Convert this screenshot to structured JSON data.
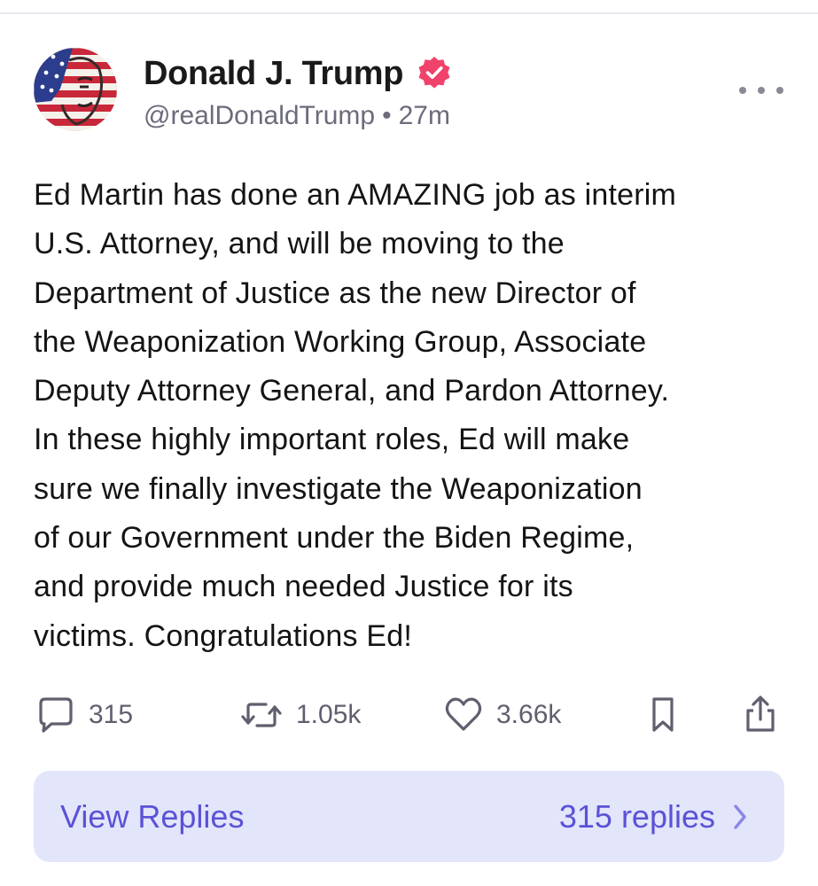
{
  "post": {
    "author": {
      "display_name": "Donald J. Trump",
      "handle": "@realDonaldTrump",
      "verified": true
    },
    "separator": "•",
    "time_ago": "27m",
    "body": "Ed Martin has done an AMAZING job as interim\nU.S. Attorney, and will be moving to the\nDepartment of Justice as the new Director of\nthe Weaponization Working Group, Associate\nDeputy Attorney General, and Pardon Attorney.\nIn these highly important roles, Ed will make\nsure we finally investigate the Weaponization\nof our Government under the Biden Regime,\nand provide much needed Justice for its\nvictims. Congratulations Ed!",
    "actions": {
      "replies_count": "315",
      "reposts_count": "1.05k",
      "likes_count": "3.66k"
    },
    "view_replies": {
      "label": "View Replies",
      "count_label": "315 replies"
    }
  },
  "icons": {
    "avatar": "flag-face-avatar",
    "verified": "verified-badge-icon",
    "more": "more-options-icon",
    "reply": "comment-icon",
    "repost": "repost-icon",
    "like": "heart-icon",
    "bookmark": "bookmark-icon",
    "share": "share-icon",
    "chevron": "chevron-right-icon"
  },
  "colors": {
    "verified_badge": "#f0426b",
    "accent": "#5a52d6",
    "view_replies_bg": "#e3e5fb",
    "secondary_text": "#6b6b7b"
  }
}
